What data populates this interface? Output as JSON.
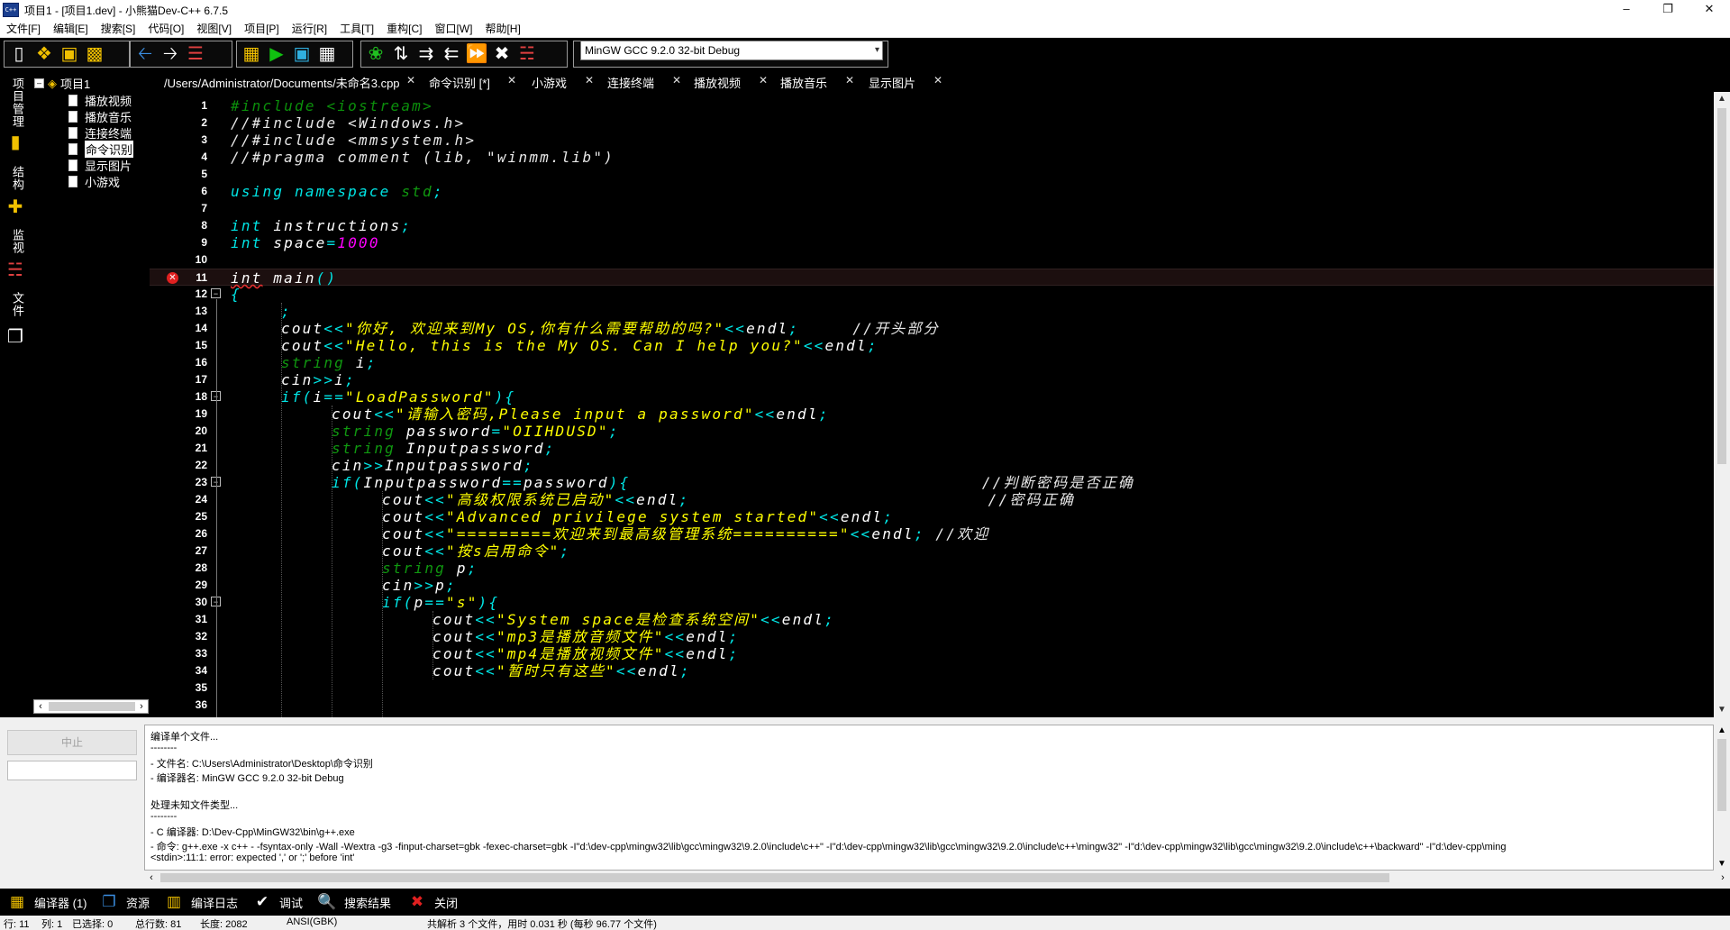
{
  "window": {
    "title": "项目1 - [项目1.dev] - 小熊猫Dev-C++ 6.7.5",
    "app_icon_text": "C++",
    "minimize": "–",
    "maximize": "❐",
    "close": "✕"
  },
  "menu": [
    "文件[F]",
    "编辑[E]",
    "搜索[S]",
    "代码[O]",
    "视图[V]",
    "项目[P]",
    "运行[R]",
    "工具[T]",
    "重构[C]",
    "窗口[W]",
    "帮助[H]"
  ],
  "toolbar": {
    "compiler": "MinGW GCC 9.2.0 32-bit Debug",
    "dropdown_arrow": "▾"
  },
  "side_tabs": {
    "project": "项目管理",
    "structure": "结构",
    "watch": "监视",
    "files": "文件"
  },
  "project_tree": {
    "root": "项目1",
    "toggle": "–",
    "files": [
      "播放视频",
      "播放音乐",
      "连接终端",
      "命令识别",
      "显示图片",
      "小游戏"
    ],
    "selected_index": 3,
    "scroll_left": "‹",
    "scroll_right": "›"
  },
  "editor_tabs": [
    {
      "label": "/Users/Administrator/Documents/未命名3.cpp",
      "close": "✕"
    },
    {
      "label": "命令识别 [*]",
      "close": "✕"
    },
    {
      "label": "小游戏",
      "close": "✕"
    },
    {
      "label": "连接终端",
      "close": "✕"
    },
    {
      "label": "播放视频",
      "close": "✕"
    },
    {
      "label": "播放音乐",
      "close": "✕"
    },
    {
      "label": "显示图片",
      "close": "✕"
    }
  ],
  "editor": {
    "current_line": 11,
    "error_line": 11,
    "lines": [
      {
        "n": 1,
        "indent": 0,
        "tokens": [
          [
            "pp",
            "#include <iostream>"
          ]
        ]
      },
      {
        "n": 2,
        "indent": 0,
        "tokens": [
          [
            "cm",
            "//#include <Windows.h>"
          ]
        ]
      },
      {
        "n": 3,
        "indent": 0,
        "tokens": [
          [
            "cm",
            "//#include <mmsystem.h>"
          ]
        ]
      },
      {
        "n": 4,
        "indent": 0,
        "tokens": [
          [
            "cm",
            "//#pragma comment (lib, \"winmm.lib\")"
          ]
        ]
      },
      {
        "n": 5,
        "indent": 0,
        "tokens": []
      },
      {
        "n": 6,
        "indent": 0,
        "tokens": [
          [
            "kw",
            "using namespace "
          ],
          [
            "std",
            "std"
          ],
          [
            "op",
            ";"
          ]
        ]
      },
      {
        "n": 7,
        "indent": 0,
        "tokens": []
      },
      {
        "n": 8,
        "indent": 0,
        "tokens": [
          [
            "ty",
            "int "
          ],
          [
            "id",
            "instructions"
          ],
          [
            "op",
            ";"
          ]
        ]
      },
      {
        "n": 9,
        "indent": 0,
        "tokens": [
          [
            "ty",
            "int "
          ],
          [
            "id",
            "space"
          ],
          [
            "op",
            "="
          ],
          [
            "num",
            "1000"
          ]
        ]
      },
      {
        "n": 10,
        "indent": 0,
        "tokens": []
      },
      {
        "n": 11,
        "indent": 0,
        "tokens": [
          [
            "err",
            "int"
          ],
          [
            "id",
            " main"
          ],
          [
            "op",
            "()"
          ]
        ]
      },
      {
        "n": 12,
        "indent": 0,
        "fold": "–",
        "tokens": [
          [
            "op",
            "{"
          ]
        ]
      },
      {
        "n": 13,
        "indent": 1,
        "tokens": [
          [
            "op",
            ";"
          ]
        ]
      },
      {
        "n": 14,
        "indent": 1,
        "tokens": [
          [
            "id",
            "cout"
          ],
          [
            "op",
            "<<"
          ],
          [
            "str",
            "\"你好, 欢迎来到My OS,你有什么需要帮助的吗?\""
          ],
          [
            "op",
            "<<"
          ],
          [
            "id",
            "endl"
          ],
          [
            "op",
            ";     "
          ],
          [
            "cm",
            "//开头部分"
          ]
        ]
      },
      {
        "n": 15,
        "indent": 1,
        "tokens": [
          [
            "id",
            "cout"
          ],
          [
            "op",
            "<<"
          ],
          [
            "str",
            "\"Hello, this is the My OS. Can I help you?\""
          ],
          [
            "op",
            "<<"
          ],
          [
            "id",
            "endl"
          ],
          [
            "op",
            ";"
          ]
        ]
      },
      {
        "n": 16,
        "indent": 1,
        "tokens": [
          [
            "gr",
            "string "
          ],
          [
            "id",
            "i"
          ],
          [
            "op",
            ";"
          ]
        ]
      },
      {
        "n": 17,
        "indent": 1,
        "tokens": [
          [
            "id",
            "cin"
          ],
          [
            "op",
            ">>"
          ],
          [
            "id",
            "i"
          ],
          [
            "op",
            ";"
          ]
        ]
      },
      {
        "n": 18,
        "indent": 1,
        "fold": "–",
        "tokens": [
          [
            "kw",
            "if"
          ],
          [
            "op",
            "("
          ],
          [
            "id",
            "i"
          ],
          [
            "op",
            "=="
          ],
          [
            "str",
            "\"LoadPassword\""
          ],
          [
            "op",
            "){"
          ]
        ]
      },
      {
        "n": 19,
        "indent": 2,
        "tokens": [
          [
            "id",
            "cout"
          ],
          [
            "op",
            "<<"
          ],
          [
            "str",
            "\"请输入密码,Please input a password\""
          ],
          [
            "op",
            "<<"
          ],
          [
            "id",
            "endl"
          ],
          [
            "op",
            ";"
          ]
        ]
      },
      {
        "n": 20,
        "indent": 2,
        "tokens": [
          [
            "gr",
            "string "
          ],
          [
            "id",
            "password"
          ],
          [
            "op",
            "="
          ],
          [
            "str",
            "\"OIIHDUSD\""
          ],
          [
            "op",
            ";"
          ]
        ]
      },
      {
        "n": 21,
        "indent": 2,
        "tokens": [
          [
            "gr",
            "string "
          ],
          [
            "id",
            "Inputpassword"
          ],
          [
            "op",
            ";"
          ]
        ]
      },
      {
        "n": 22,
        "indent": 2,
        "tokens": [
          [
            "id",
            "cin"
          ],
          [
            "op",
            ">>"
          ],
          [
            "id",
            "Inputpassword"
          ],
          [
            "op",
            ";"
          ]
        ]
      },
      {
        "n": 23,
        "indent": 2,
        "fold": "–",
        "tokens": [
          [
            "kw",
            "if"
          ],
          [
            "op",
            "("
          ],
          [
            "id",
            "Inputpassword"
          ],
          [
            "op",
            "=="
          ],
          [
            "id",
            "password"
          ],
          [
            "op",
            "){                                 "
          ],
          [
            "cm",
            "//判断密码是否正确"
          ]
        ]
      },
      {
        "n": 24,
        "indent": 3,
        "tokens": [
          [
            "id",
            "cout"
          ],
          [
            "op",
            "<<"
          ],
          [
            "str",
            "\"高级权限系统已启动\""
          ],
          [
            "op",
            "<<"
          ],
          [
            "id",
            "endl"
          ],
          [
            "op",
            ";                            "
          ],
          [
            "cm",
            "//密码正确"
          ]
        ]
      },
      {
        "n": 25,
        "indent": 3,
        "tokens": [
          [
            "id",
            "cout"
          ],
          [
            "op",
            "<<"
          ],
          [
            "str",
            "\"Advanced privilege system started\""
          ],
          [
            "op",
            "<<"
          ],
          [
            "id",
            "endl"
          ],
          [
            "op",
            ";"
          ]
        ]
      },
      {
        "n": 26,
        "indent": 3,
        "tokens": [
          [
            "id",
            "cout"
          ],
          [
            "op",
            "<<"
          ],
          [
            "str",
            "\"=========欢迎来到最高级管理系统==========\""
          ],
          [
            "op",
            "<<"
          ],
          [
            "id",
            "endl"
          ],
          [
            "op",
            "; "
          ],
          [
            "cm",
            "//欢迎"
          ]
        ]
      },
      {
        "n": 27,
        "indent": 3,
        "tokens": [
          [
            "id",
            "cout"
          ],
          [
            "op",
            "<<"
          ],
          [
            "str",
            "\"按s启用命令\""
          ],
          [
            "op",
            ";"
          ]
        ]
      },
      {
        "n": 28,
        "indent": 3,
        "tokens": [
          [
            "gr",
            "string "
          ],
          [
            "id",
            "p"
          ],
          [
            "op",
            ";"
          ]
        ]
      },
      {
        "n": 29,
        "indent": 3,
        "tokens": [
          [
            "id",
            "cin"
          ],
          [
            "op",
            ">>"
          ],
          [
            "id",
            "p"
          ],
          [
            "op",
            ";"
          ]
        ]
      },
      {
        "n": 30,
        "indent": 3,
        "fold": "–",
        "tokens": [
          [
            "kw",
            "if"
          ],
          [
            "op",
            "("
          ],
          [
            "id",
            "p"
          ],
          [
            "op",
            "=="
          ],
          [
            "str",
            "\"s\""
          ],
          [
            "op",
            "){"
          ]
        ]
      },
      {
        "n": 31,
        "indent": 4,
        "tokens": [
          [
            "id",
            "cout"
          ],
          [
            "op",
            "<<"
          ],
          [
            "str",
            "\"System space是检查系统空间\""
          ],
          [
            "op",
            "<<"
          ],
          [
            "id",
            "endl"
          ],
          [
            "op",
            ";"
          ]
        ]
      },
      {
        "n": 32,
        "indent": 4,
        "tokens": [
          [
            "id",
            "cout"
          ],
          [
            "op",
            "<<"
          ],
          [
            "str",
            "\"mp3是播放音频文件\""
          ],
          [
            "op",
            "<<"
          ],
          [
            "id",
            "endl"
          ],
          [
            "op",
            ";"
          ]
        ]
      },
      {
        "n": 33,
        "indent": 4,
        "tokens": [
          [
            "id",
            "cout"
          ],
          [
            "op",
            "<<"
          ],
          [
            "str",
            "\"mp4是播放视频文件\""
          ],
          [
            "op",
            "<<"
          ],
          [
            "id",
            "endl"
          ],
          [
            "op",
            ";"
          ]
        ]
      },
      {
        "n": 34,
        "indent": 4,
        "tokens": [
          [
            "id",
            "cout"
          ],
          [
            "op",
            "<<"
          ],
          [
            "str",
            "\"暂时只有这些\""
          ],
          [
            "op",
            "<<"
          ],
          [
            "id",
            "endl"
          ],
          [
            "op",
            ";"
          ]
        ]
      },
      {
        "n": 35,
        "indent": 0,
        "tokens": []
      },
      {
        "n": 36,
        "indent": 0,
        "tokens": []
      }
    ]
  },
  "bottom": {
    "stop_button": "中止",
    "log_lines": [
      "编译单个文件...",
      "--------",
      "- 文件名: C:\\Users\\Administrator\\Desktop\\命令识别",
      "- 编译器名: MinGW GCC 9.2.0 32-bit Debug",
      "",
      "处理未知文件类型...",
      "--------",
      "- C 编译器: D:\\Dev-Cpp\\MinGW32\\bin\\g++.exe",
      "- 命令: g++.exe -x c++ - -fsyntax-only -Wall -Wextra -g3 -finput-charset=gbk -fexec-charset=gbk -I\"d:\\dev-cpp\\mingw32\\lib\\gcc\\mingw32\\9.2.0\\include\\c++\" -I\"d:\\dev-cpp\\mingw32\\lib\\gcc\\mingw32\\9.2.0\\include\\c++\\mingw32\" -I\"d:\\dev-cpp\\mingw32\\lib\\gcc\\mingw32\\9.2.0\\include\\c++\\backward\" -I\"d:\\dev-cpp\\ming",
      "<stdin>:11:1: error: expected ',' or ';' before 'int'"
    ],
    "tabs": [
      "编译器 (1)",
      "资源",
      "编译日志",
      "调试",
      "搜索结果",
      "关闭"
    ]
  },
  "status": {
    "line": "行: 11",
    "col": "列: 1",
    "selected": "已选择: 0",
    "total": "总行数: 81",
    "length": "长度: 2082",
    "encoding": "ANSI(GBK)",
    "parse": "共解析 3 个文件，用时 0.031 秒 (每秒 96.77 个文件)"
  }
}
